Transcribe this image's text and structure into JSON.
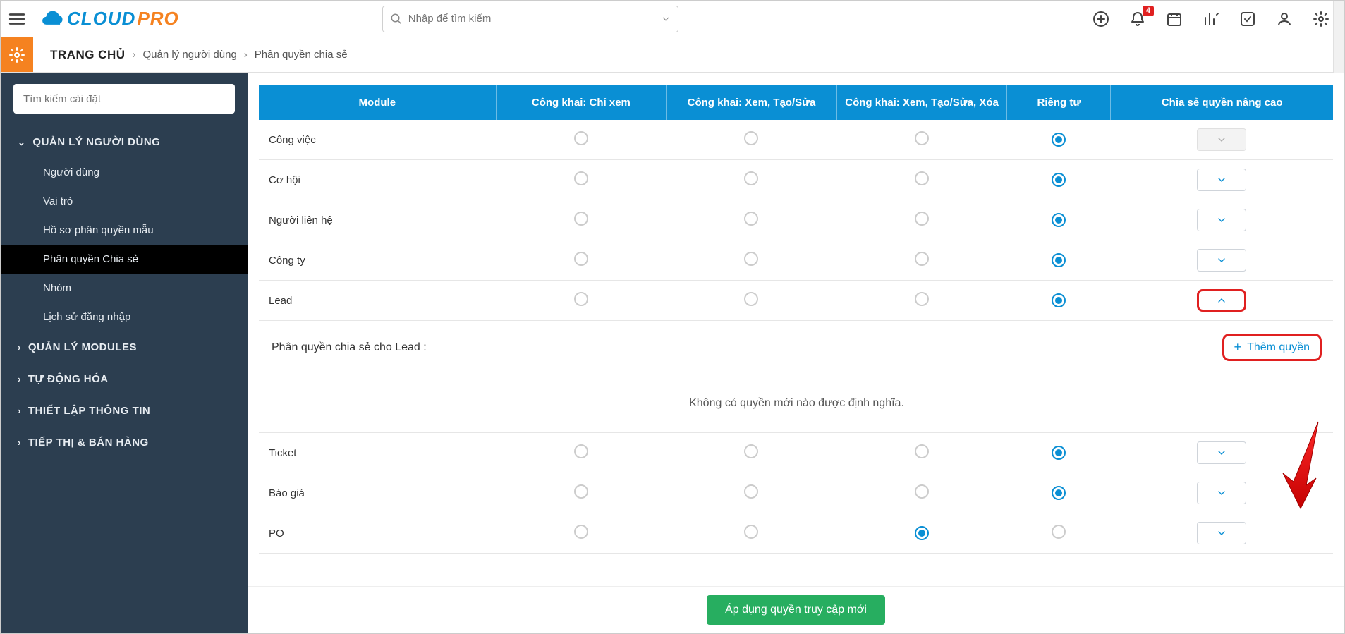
{
  "header": {
    "search_placeholder": "Nhập để tìm kiếm",
    "notification_count": "4"
  },
  "breadcrumb": {
    "home": "TRANG CHỦ",
    "level1": "Quản lý người dùng",
    "level2": "Phân quyền chia sẻ"
  },
  "sidebar": {
    "search_placeholder": "Tìm kiếm cài đặt",
    "group_users": "QUẢN LÝ NGƯỜI DÙNG",
    "items": {
      "users": "Người dùng",
      "roles": "Vai trò",
      "profiles": "Hồ sơ phân quyền mẫu",
      "sharing": "Phân quyền Chia sẻ",
      "groups": "Nhóm",
      "login_history": "Lịch sử đăng nhập"
    },
    "group_modules": "QUẢN LÝ MODULES",
    "group_automation": "TỰ ĐỘNG HÓA",
    "group_config": "THIẾT LẬP THÔNG TIN",
    "group_marketing": "TIẾP THỊ & BÁN HÀNG"
  },
  "table": {
    "headers": {
      "module": "Module",
      "public_read": "Công khai: Chỉ xem",
      "public_rw": "Công khai: Xem, Tạo/Sửa",
      "public_rwd": "Công khai: Xem, Tạo/Sửa, Xóa",
      "private": "Riêng tư",
      "advanced": "Chia sẻ quyền nâng cao"
    },
    "rows": [
      {
        "module": "Công việc",
        "selected": "private",
        "expand": "disabled"
      },
      {
        "module": "Cơ hội",
        "selected": "private",
        "expand": "collapsed"
      },
      {
        "module": "Người liên hệ",
        "selected": "private",
        "expand": "collapsed"
      },
      {
        "module": "Công ty",
        "selected": "private",
        "expand": "collapsed"
      },
      {
        "module": "Lead",
        "selected": "private",
        "expand": "expanded"
      },
      {
        "module": "Ticket",
        "selected": "private",
        "expand": "collapsed"
      },
      {
        "module": "Báo giá",
        "selected": "private",
        "expand": "collapsed"
      },
      {
        "module": "PO",
        "selected": "public_rwd",
        "expand": "collapsed"
      }
    ]
  },
  "lead_detail": {
    "title": "Phân quyền chia sẻ cho Lead :",
    "add_label": "Thêm quyền",
    "empty": "Không có quyền mới nào được định nghĩa."
  },
  "footer": {
    "apply": "Áp dụng quyền truy cập mới"
  }
}
